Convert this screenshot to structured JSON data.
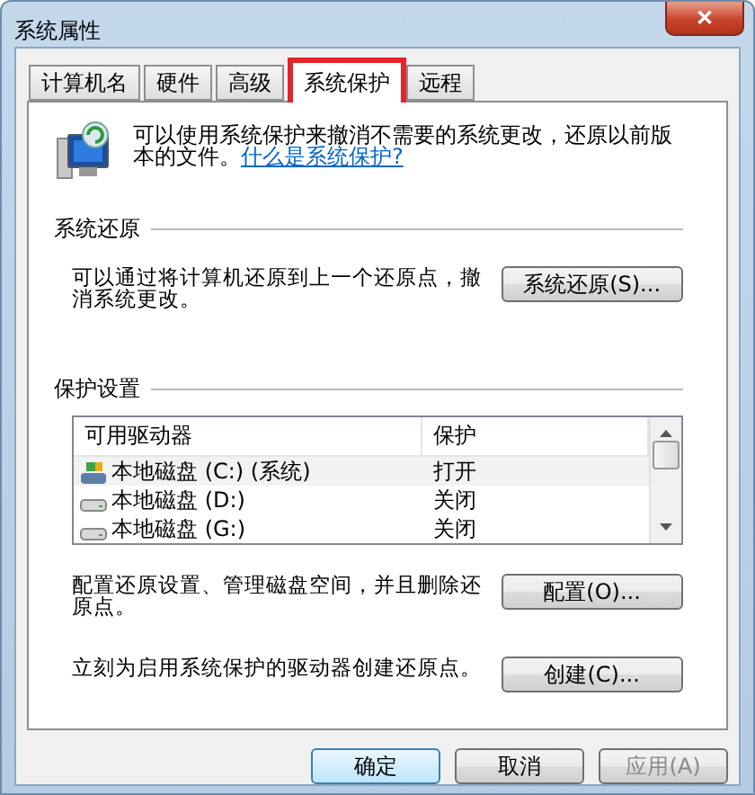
{
  "window": {
    "title": "系统属性",
    "close": "✕"
  },
  "tabs": [
    {
      "label": "计算机名",
      "selected": false,
      "highlighted": false
    },
    {
      "label": "硬件",
      "selected": false,
      "highlighted": false
    },
    {
      "label": "高级",
      "selected": false,
      "highlighted": false
    },
    {
      "label": "系统保护",
      "selected": true,
      "highlighted": true
    },
    {
      "label": "远程",
      "selected": false,
      "highlighted": false
    }
  ],
  "intro": {
    "text": "可以使用系统保护来撤消不需要的系统更改，还原以前版本的文件。",
    "link": "什么是系统保护?"
  },
  "restore": {
    "heading": "系统还原",
    "text": "可以通过将计算机还原到上一个还原点，撤消系统更改。",
    "button": "系统还原(S)..."
  },
  "protection": {
    "heading": "保护设置",
    "columns": [
      "可用驱动器",
      "保护"
    ],
    "rows": [
      {
        "drive": "本地磁盘 (C:) (系统)",
        "protection": "打开",
        "kind": "system",
        "selected": true
      },
      {
        "drive": "本地磁盘 (D:)",
        "protection": "关闭",
        "kind": "disk",
        "selected": false
      },
      {
        "drive": "本地磁盘 (G:)",
        "protection": "关闭",
        "kind": "disk",
        "selected": false
      }
    ],
    "configure_text": "配置还原设置、管理磁盘空间，并且删除还原点。",
    "configure_button": "配置(O)...",
    "create_text": "立刻为启用系统保护的驱动器创建还原点。",
    "create_button": "创建(C)..."
  },
  "buttons": [
    {
      "label": "确定",
      "default": true,
      "disabled": false
    },
    {
      "label": "取消",
      "default": false,
      "disabled": false
    },
    {
      "label": "应用(A)",
      "default": false,
      "disabled": true
    }
  ]
}
